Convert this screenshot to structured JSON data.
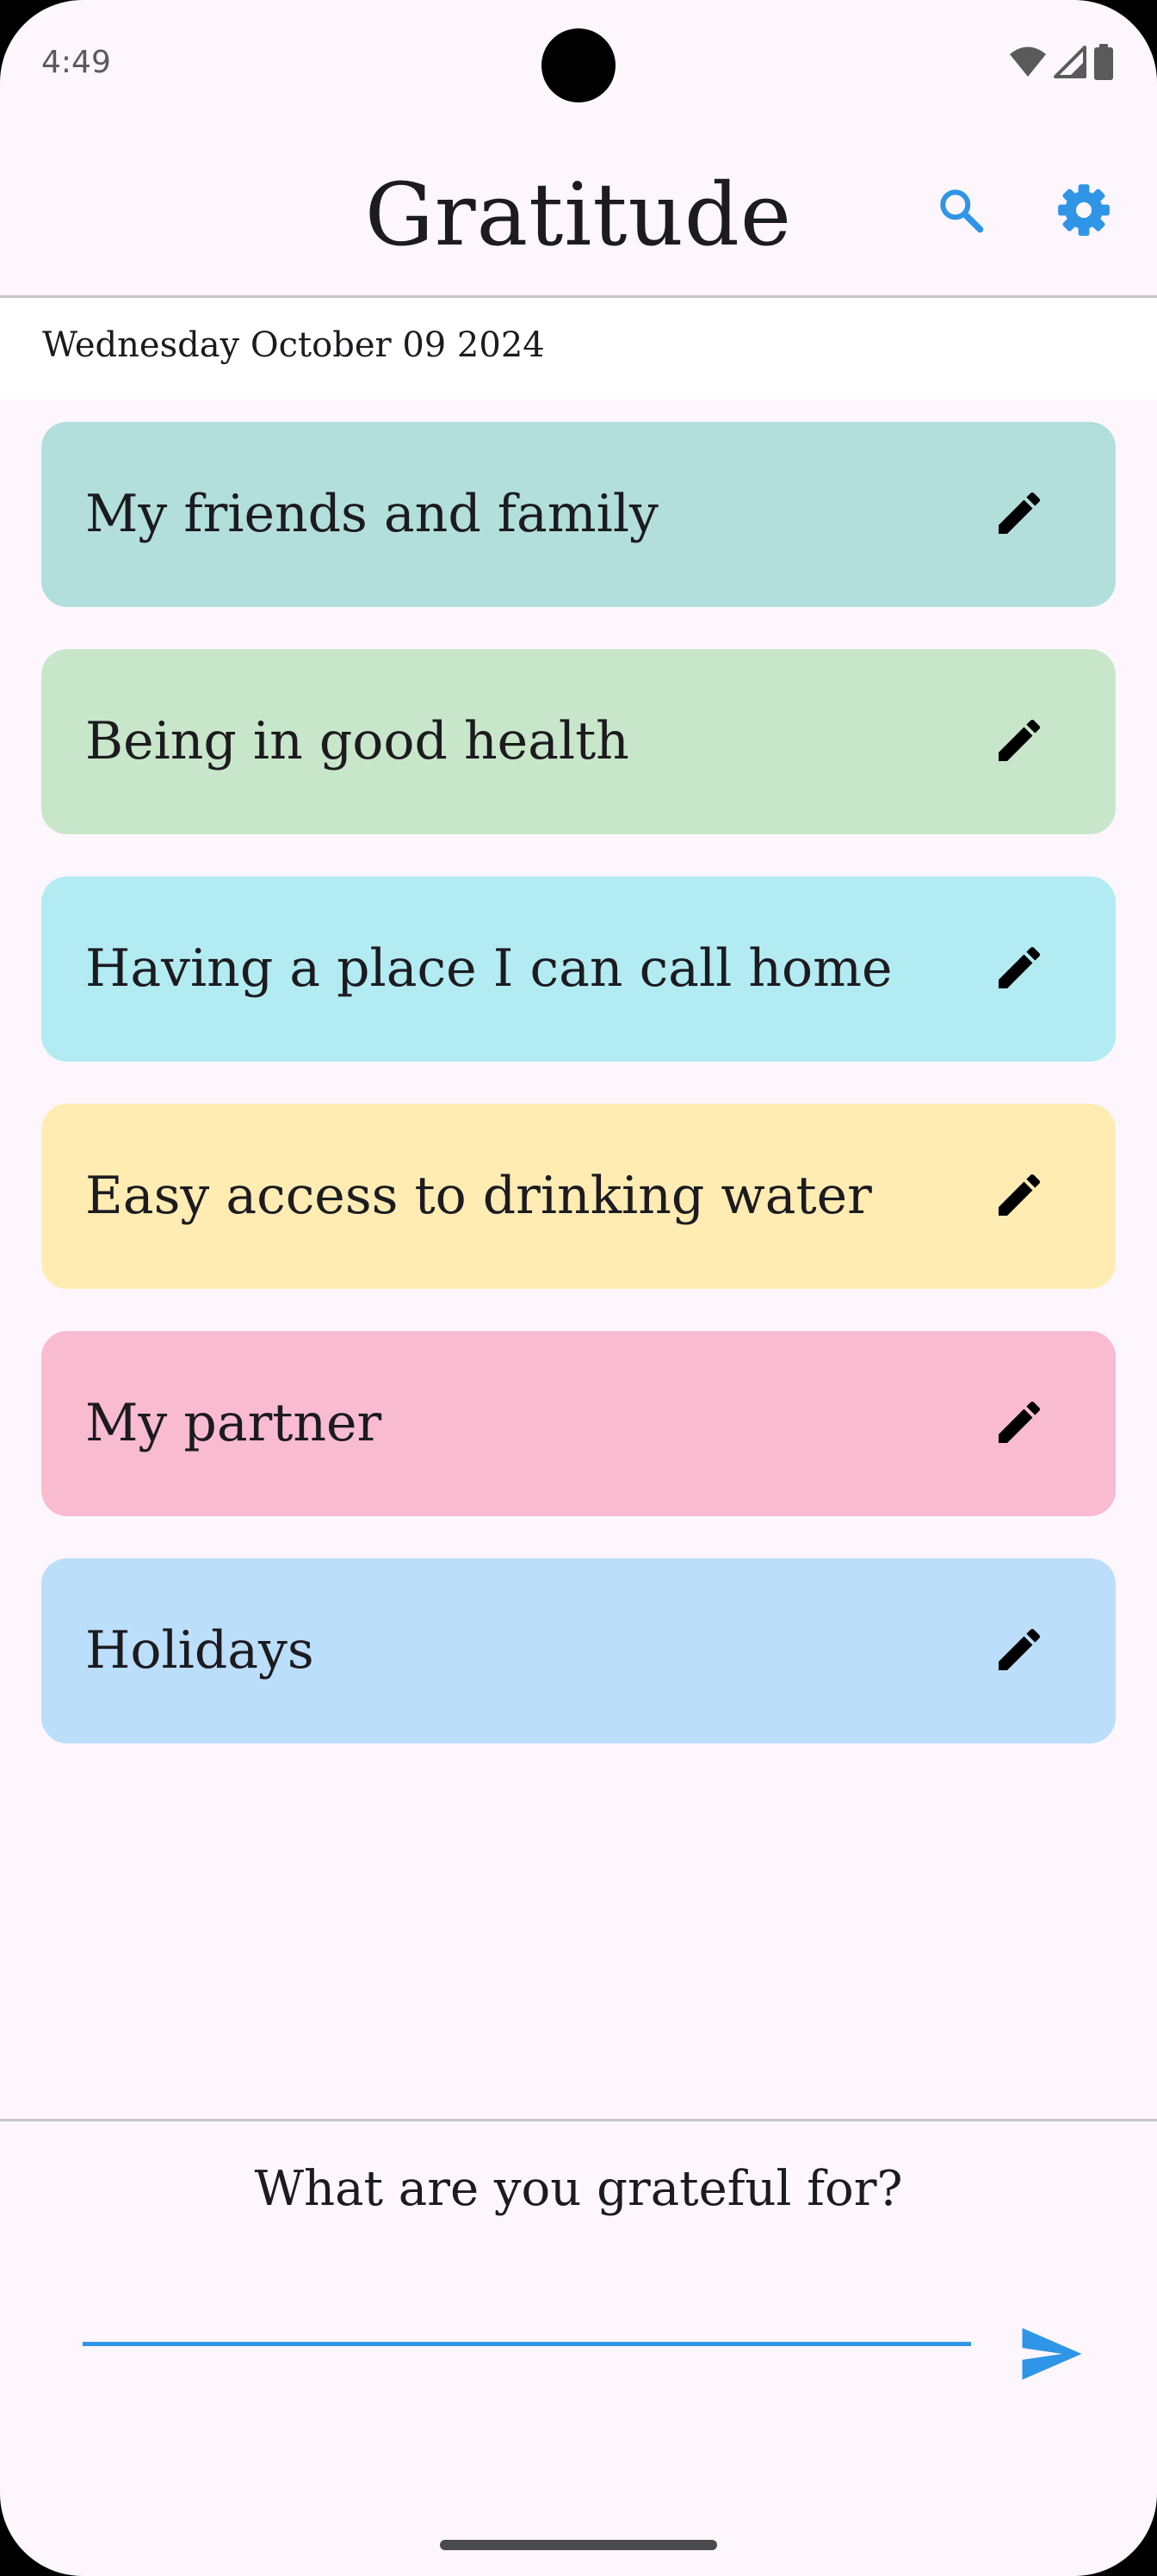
{
  "status_bar": {
    "time": "4:49",
    "icons": [
      "wifi-icon",
      "cell-signal-icon",
      "battery-icon"
    ]
  },
  "app_bar": {
    "title": "Gratitude",
    "actions": [
      "search-icon",
      "settings-icon"
    ],
    "accent_color": "#2f95e6"
  },
  "date": "Wednesday October 09 2024",
  "entries": [
    {
      "text": "My friends and family",
      "color": "#b2dfdb"
    },
    {
      "text": "Being in good health",
      "color": "#c8e6c9"
    },
    {
      "text": "Having a place I can call home",
      "color": "#b2ebf2"
    },
    {
      "text": "Easy access to drinking water",
      "color": "#ffecb3"
    },
    {
      "text": "My partner",
      "color": "#f8bbd0"
    },
    {
      "text": "Holidays",
      "color": "#bbdefb"
    }
  ],
  "entry_action_icon": "edit-pencil-icon",
  "composer": {
    "prompt": "What are you grateful for?",
    "value": "",
    "send_icon": "send-icon"
  }
}
